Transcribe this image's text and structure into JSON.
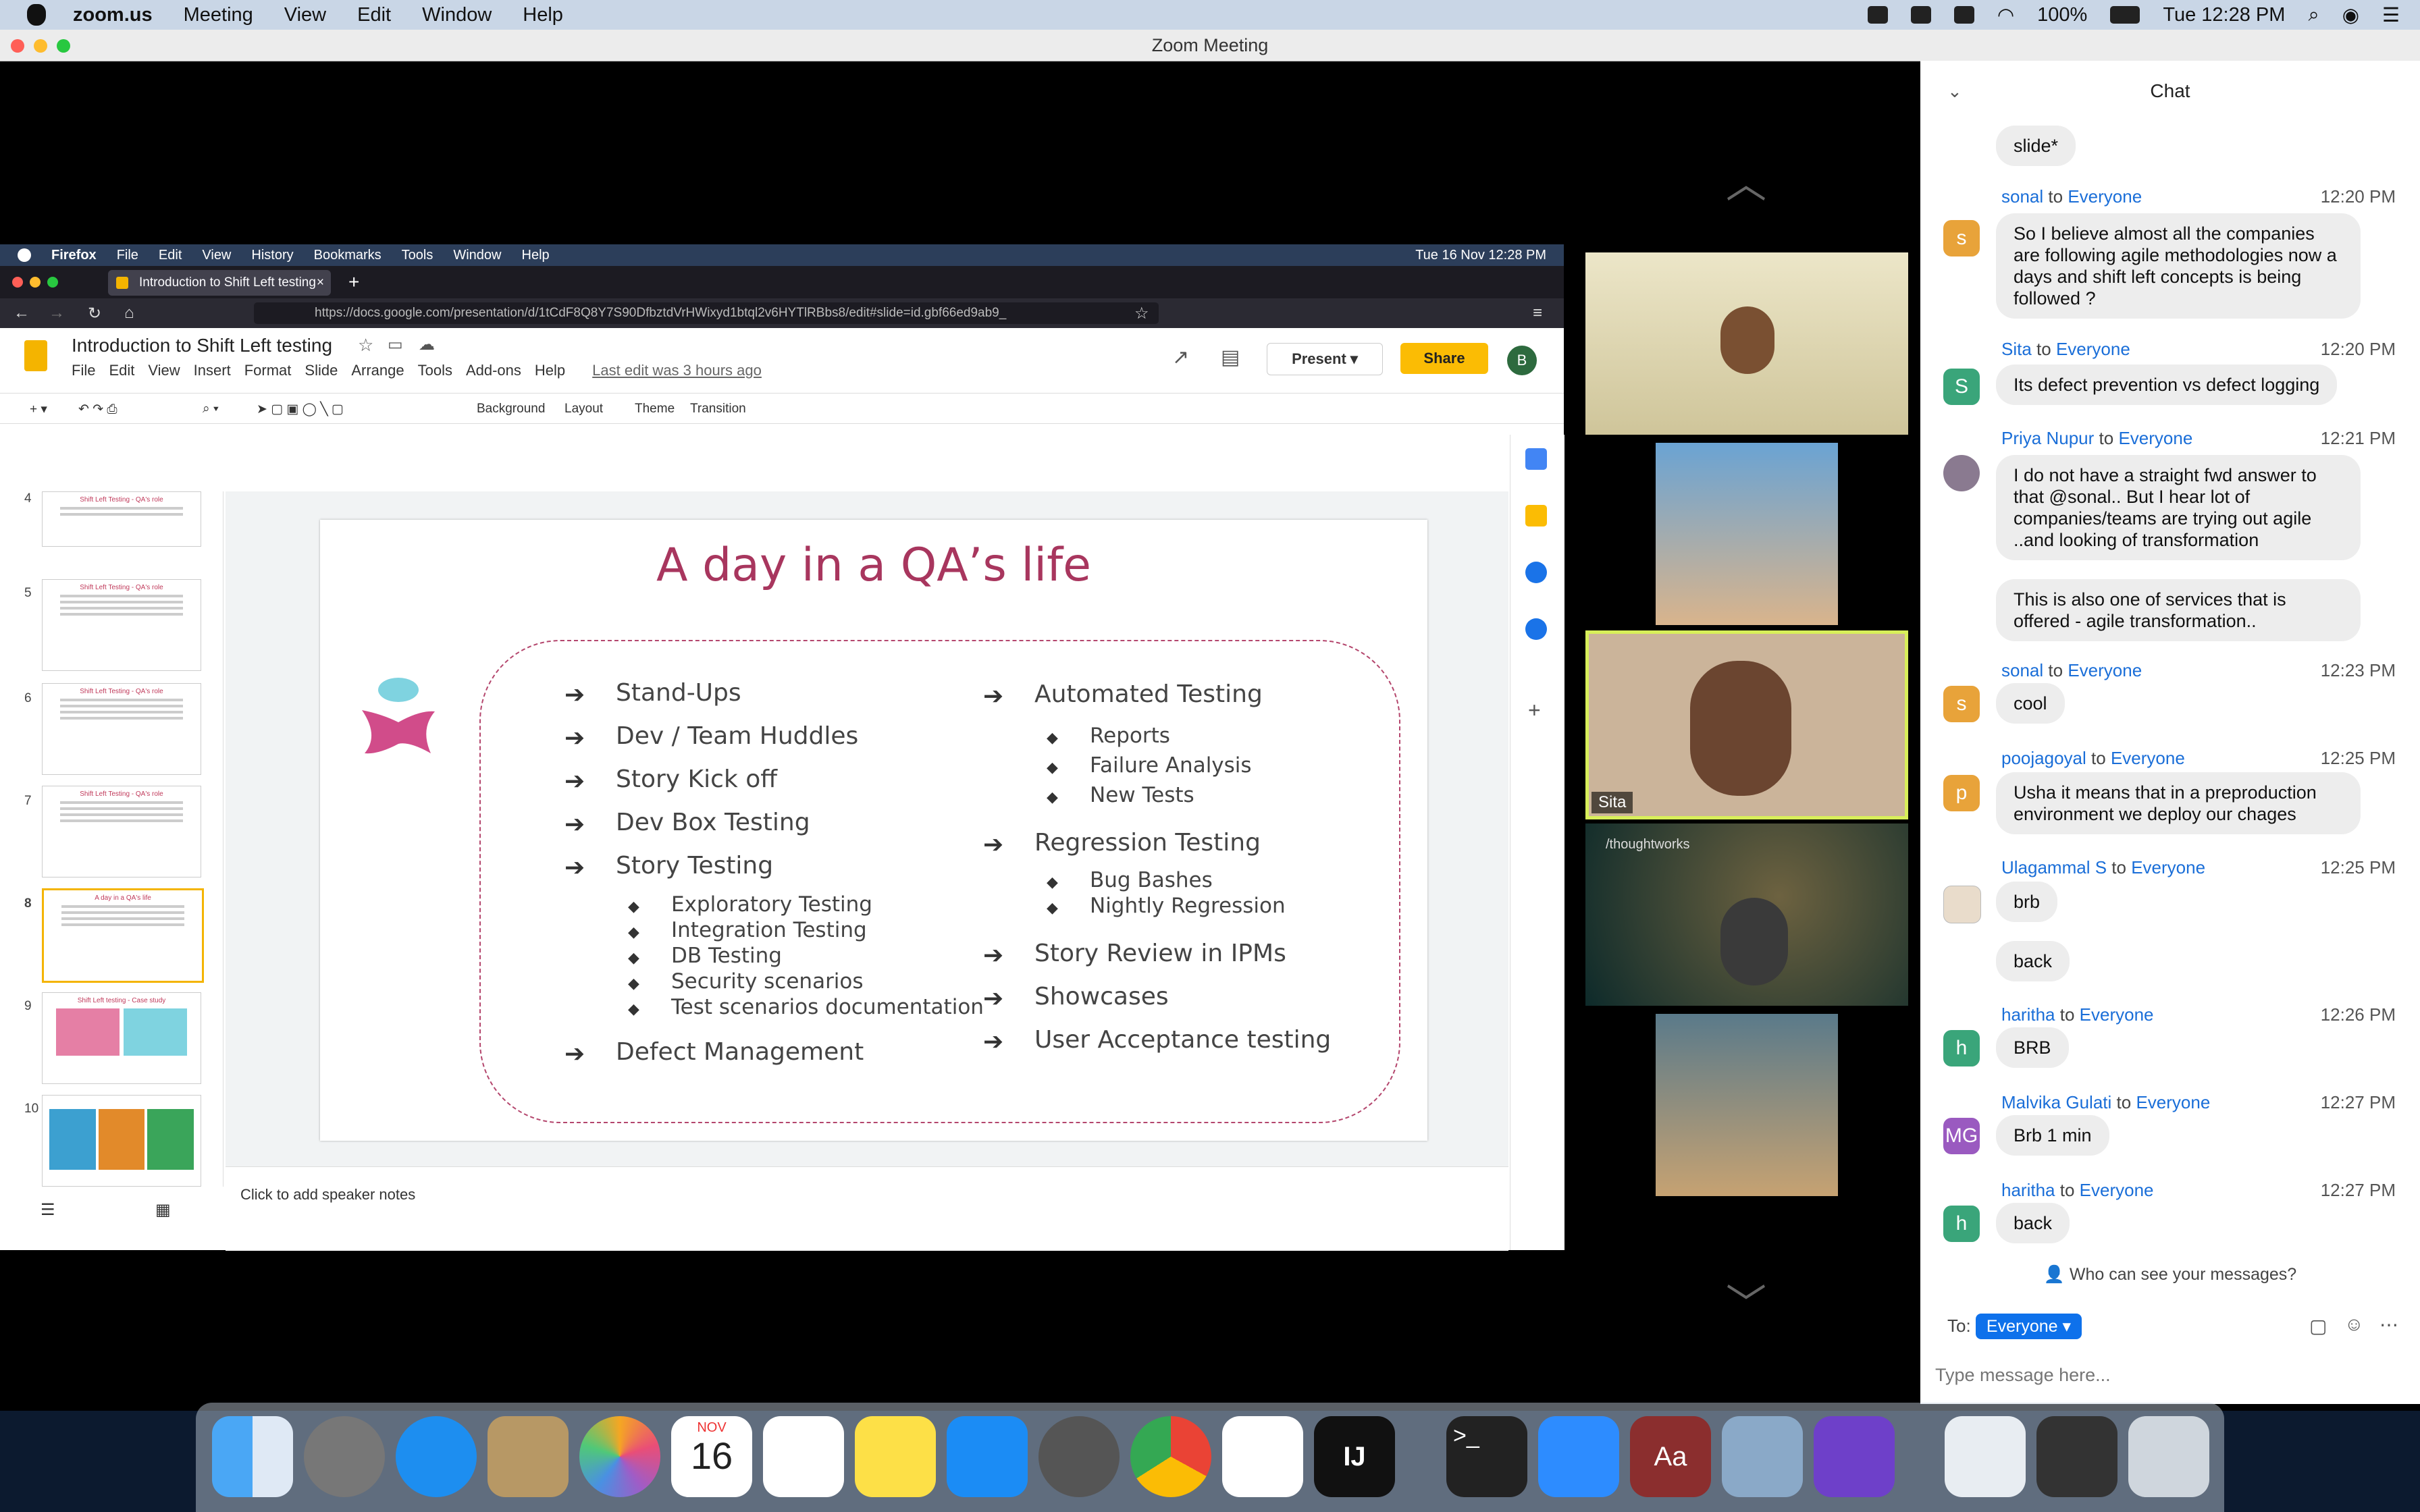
{
  "menubar": {
    "app": "zoom.us",
    "items": [
      "Meeting",
      "View",
      "Edit",
      "Window",
      "Help"
    ],
    "battery": "100%",
    "clock": "Tue 12:28 PM"
  },
  "window": {
    "title": "Zoom Meeting"
  },
  "firefox": {
    "menu": [
      "Firefox",
      "File",
      "Edit",
      "View",
      "History",
      "Bookmarks",
      "Tools",
      "Window",
      "Help"
    ],
    "clock": "Tue 16 Nov  12:28 PM",
    "tab_title": "Introduction to Shift Left testing",
    "url": "https://docs.google.com/presentation/d/1tCdF8Q8Y7S90DfbztdVrHWixyd1btql2v6HYTlRBbs8/edit#slide=id.gbf66ed9ab9_"
  },
  "slides": {
    "doc_title": "Introduction to Shift Left testing",
    "menu": [
      "File",
      "Edit",
      "View",
      "Insert",
      "Format",
      "Slide",
      "Arrange",
      "Tools",
      "Add-ons",
      "Help"
    ],
    "last_edit": "Last edit was 3 hours ago",
    "present": "Present",
    "share": "Share",
    "avatar": "B",
    "toolbar": {
      "background": "Background",
      "layout": "Layout",
      "theme": "Theme",
      "transition": "Transition"
    },
    "thumbs": [
      {
        "num": "4",
        "title": "Shift Left Testing - QA's role"
      },
      {
        "num": "5",
        "title": "Shift Left Testing - QA's role"
      },
      {
        "num": "6",
        "title": "Shift Left Testing - QA's role"
      },
      {
        "num": "7",
        "title": "Shift Left Testing - QA's role"
      },
      {
        "num": "8",
        "title": "A day in a QA's life"
      },
      {
        "num": "9",
        "title": "Shift Left testing - Case study"
      },
      {
        "num": "10",
        "title": ""
      }
    ],
    "speaker_notes": "Click to add speaker notes",
    "slide": {
      "title": "A day in a QA’s life",
      "left": [
        "Stand-Ups",
        "Dev / Team Huddles",
        "Story Kick off",
        "Dev Box Testing",
        "Story Testing"
      ],
      "left_sub": [
        "Exploratory Testing",
        "Integration Testing",
        "DB Testing",
        "Security scenarios",
        "Test scenarios documentation"
      ],
      "left_last": "Defect Management",
      "right1": "Automated Testing",
      "right1_sub": [
        "Reports",
        "Failure Analysis",
        "New Tests"
      ],
      "right2": "Regression Testing",
      "right2_sub": [
        "Bug Bashes",
        "Nightly Regression"
      ],
      "right_rest": [
        "Story Review in IPMs",
        "Showcases",
        "User Acceptance testing"
      ]
    }
  },
  "videos": {
    "active_name": "Sita",
    "brand": "/thoughtworks"
  },
  "chat": {
    "title": "Chat",
    "messages": [
      {
        "text": "slide*"
      },
      {
        "from": "sonal",
        "to": "Everyone",
        "time": "12:20 PM",
        "avatar": "s",
        "text": "So I believe almost all the companies are following agile methodologies now a days and shift left concepts is being followed ?"
      },
      {
        "from": "Sita",
        "to": "Everyone",
        "time": "12:20 PM",
        "avatar": "S",
        "text": "Its defect prevention vs defect logging"
      },
      {
        "from": "Priya Nupur",
        "to": "Everyone",
        "time": "12:21 PM",
        "text": "I do not have a straight fwd answer to that @sonal.. But I hear lot of companies/teams are trying out agile ..and looking of transformation"
      },
      {
        "text": "This is also one of services that is offered - agile transformation.."
      },
      {
        "from": "sonal",
        "to": "Everyone",
        "time": "12:23 PM",
        "avatar": "s",
        "text": "cool"
      },
      {
        "from": "poojagoyal",
        "to": "Everyone",
        "time": "12:25 PM",
        "avatar": "p",
        "text": "Usha it means that in a preproduction environment we deploy our chages"
      },
      {
        "from": "Ulagammal  S",
        "to": "Everyone",
        "time": "12:25 PM",
        "text": "brb"
      },
      {
        "text": "back"
      },
      {
        "from": "haritha",
        "to": "Everyone",
        "time": "12:26 PM",
        "avatar": "h",
        "text": "BRB"
      },
      {
        "from": "Malvika Gulati",
        "to": "Everyone",
        "time": "12:27 PM",
        "avatar": "MG",
        "text": "Brb 1 min"
      },
      {
        "from": "haritha",
        "to": "Everyone",
        "time": "12:27 PM",
        "avatar": "h",
        "text": "back"
      }
    ],
    "to_word": "to",
    "who_can_see": "Who can see your messages?",
    "to_label": "To:",
    "recipient": "Everyone",
    "placeholder": "Type message here..."
  },
  "dock": {
    "calendar_month": "NOV",
    "calendar_day": "16"
  },
  "colors": {
    "accent": "#0e71eb",
    "slide_title": "#a8365e",
    "share": "#fbbc04"
  }
}
